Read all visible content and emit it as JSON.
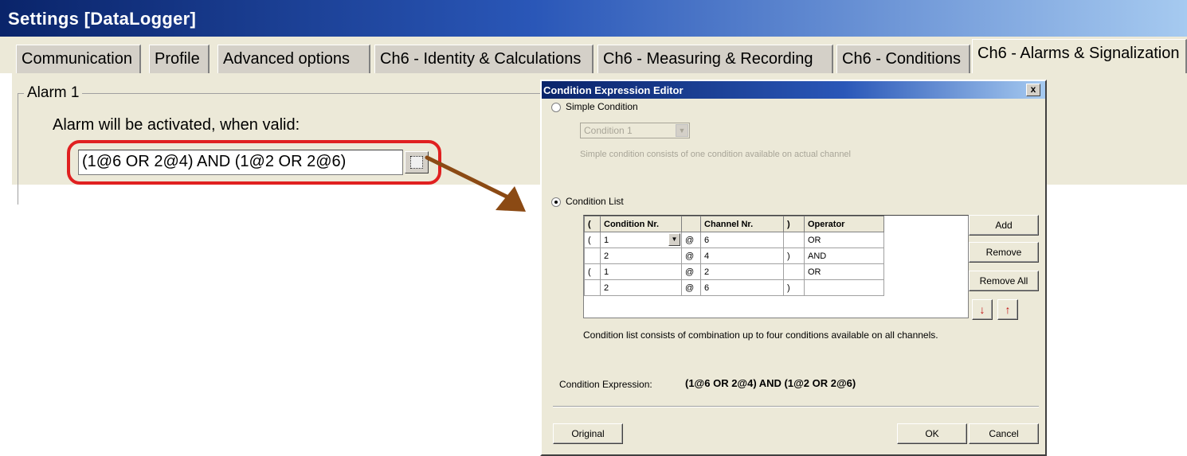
{
  "window": {
    "title": "Settings [DataLogger]"
  },
  "tabs": [
    "Communication",
    "Profile",
    "Advanced options",
    "Ch6 - Identity & Calculations",
    "Ch6 - Measuring & Recording",
    "Ch6 - Conditions",
    "Ch6 - Alarms & Signalization"
  ],
  "alarm": {
    "group_title": "Alarm 1",
    "activation_text": "Alarm will be activated, when valid:",
    "expression": "(1@6 OR 2@4) AND (1@2 OR 2@6)"
  },
  "dialog": {
    "title": "Condition Expression Editor",
    "close_glyph": "x",
    "simple_label": "Simple Condition",
    "simple_combo_value": "Condition 1",
    "simple_note": "Simple condition consists of one condition available on actual channel",
    "list_label": "Condition List",
    "columns": [
      "(",
      "Condition Nr.",
      "",
      "Channel Nr.",
      ")",
      "Operator"
    ],
    "rows": [
      [
        "(",
        "1",
        "@",
        "6",
        "",
        "OR"
      ],
      [
        "",
        "2",
        "@",
        "4",
        ")",
        "AND"
      ],
      [
        "(",
        "1",
        "@",
        "2",
        "",
        "OR"
      ],
      [
        "",
        "2",
        "@",
        "6",
        ")",
        ""
      ]
    ],
    "list_note": "Condition list consists of combination up to four conditions available on all channels.",
    "expression_label": "Condition Expression:",
    "expression_value": "(1@6 OR 2@4) AND (1@2 OR 2@6)",
    "buttons": {
      "add": "Add",
      "remove": "Remove",
      "remove_all": "Remove All",
      "move_down": "↓",
      "move_up": "↑",
      "original": "Original",
      "ok": "OK",
      "cancel": "Cancel"
    }
  },
  "colors": {
    "highlight": "#e02020",
    "arrow": "#8b4a14",
    "title_bar": "#0a246a"
  }
}
